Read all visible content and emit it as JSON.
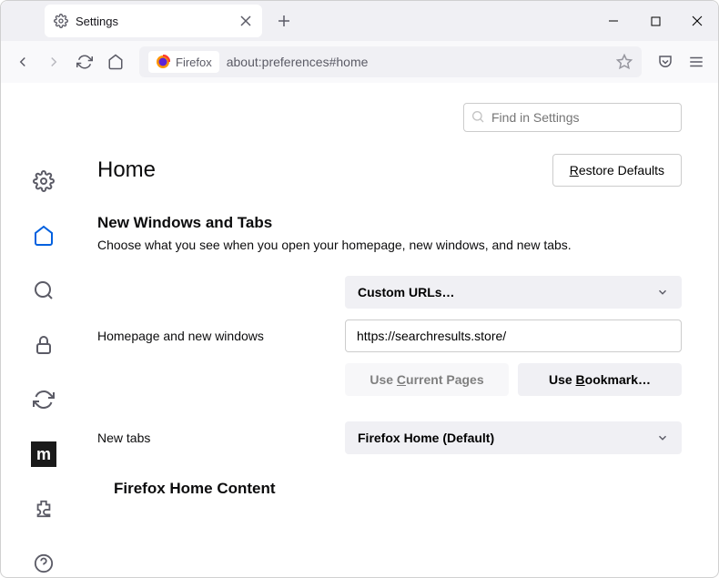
{
  "tab": {
    "title": "Settings"
  },
  "urlbar": {
    "identity_label": "Firefox",
    "url": "about:preferences#home"
  },
  "search": {
    "placeholder": "Find in Settings"
  },
  "heading": "Home",
  "restore_label": "Restore Defaults",
  "section1": {
    "title": "New Windows and Tabs",
    "desc": "Choose what you see when you open your homepage, new windows, and new tabs."
  },
  "homepage": {
    "label": "Homepage and new windows",
    "select": "Custom URLs…",
    "url_value": "https://searchresults.store/",
    "use_current": "Use Current Pages",
    "use_bookmark": "Use Bookmark…"
  },
  "newtabs": {
    "label": "New tabs",
    "select": "Firefox Home (Default)"
  },
  "section2": {
    "title": "Firefox Home Content"
  }
}
